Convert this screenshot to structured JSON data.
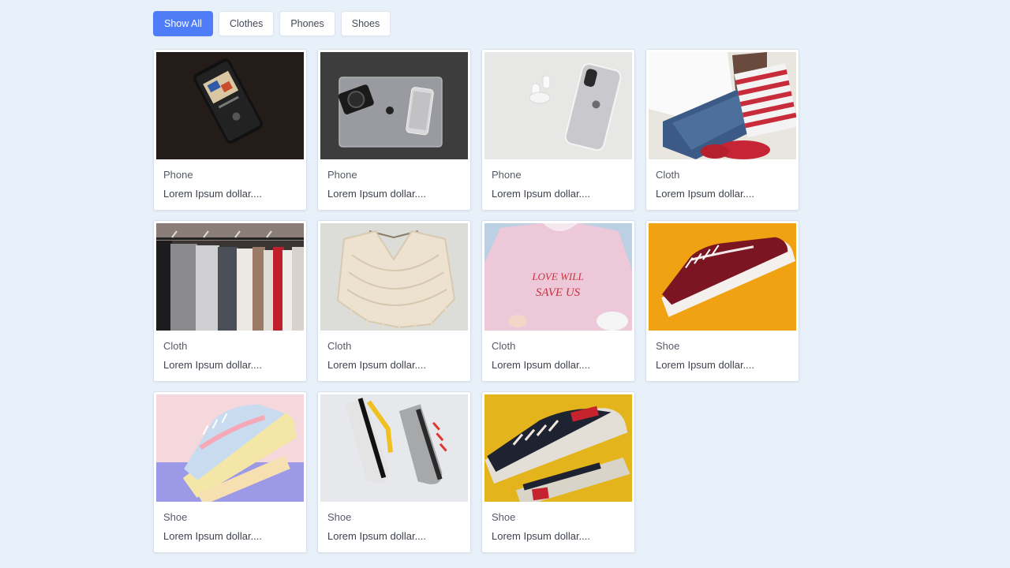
{
  "filters": [
    {
      "label": "Show All",
      "active": true
    },
    {
      "label": "Clothes",
      "active": false
    },
    {
      "label": "Phones",
      "active": false
    },
    {
      "label": "Shoes",
      "active": false
    }
  ],
  "products": [
    {
      "category": "Phone",
      "description": "Lorem Ipsum dollar....",
      "image": "phone-dark-music"
    },
    {
      "category": "Phone",
      "description": "Lorem Ipsum dollar....",
      "image": "phone-laptop-camera"
    },
    {
      "category": "Phone",
      "description": "Lorem Ipsum dollar....",
      "image": "phone-white-airpods"
    },
    {
      "category": "Cloth",
      "description": "Lorem Ipsum dollar....",
      "image": "clothes-flatlay"
    },
    {
      "category": "Cloth",
      "description": "Lorem Ipsum dollar....",
      "image": "clothes-rack"
    },
    {
      "category": "Cloth",
      "description": "Lorem Ipsum dollar....",
      "image": "knit-top"
    },
    {
      "category": "Cloth",
      "description": "Lorem Ipsum dollar....",
      "image": "pink-tshirt"
    },
    {
      "category": "Shoe",
      "description": "Lorem Ipsum dollar....",
      "image": "red-sneaker-yellow"
    },
    {
      "category": "Shoe",
      "description": "Lorem Ipsum dollar....",
      "image": "pastel-sneakers"
    },
    {
      "category": "Shoe",
      "description": "Lorem Ipsum dollar....",
      "image": "running-shoes"
    },
    {
      "category": "Shoe",
      "description": "Lorem Ipsum dollar....",
      "image": "sneakers-yellow-bg"
    }
  ],
  "tshirt_print": [
    "LOVE WILL",
    "SAVE US"
  ],
  "colors": {
    "accent": "#4f7cf7",
    "background": "#e8f0fa"
  }
}
